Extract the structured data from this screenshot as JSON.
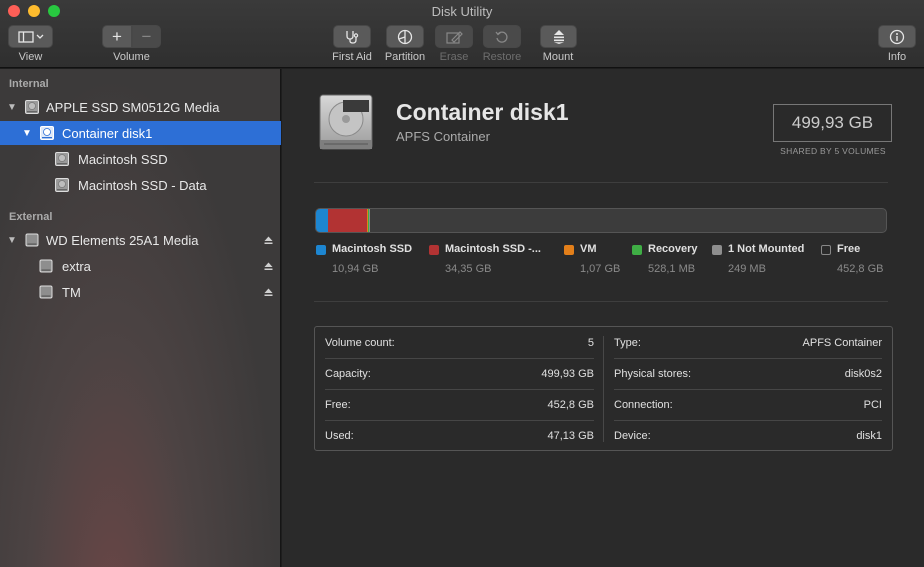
{
  "window": {
    "title": "Disk Utility"
  },
  "toolbar": {
    "view_label": "View",
    "volume_label": "Volume",
    "first_aid_label": "First Aid",
    "partition_label": "Partition",
    "erase_label": "Erase",
    "restore_label": "Restore",
    "mount_label": "Mount",
    "info_label": "Info",
    "add_glyph": "+",
    "remove_glyph": "−"
  },
  "sidebar": {
    "internal_label": "Internal",
    "external_label": "External",
    "internal_items": [
      {
        "label": "APPLE SSD SM0512G Media"
      },
      {
        "label": "Container disk1"
      },
      {
        "label": "Macintosh SSD"
      },
      {
        "label": "Macintosh SSD - Data"
      }
    ],
    "external_items": [
      {
        "label": "WD Elements 25A1 Media"
      },
      {
        "label": "extra"
      },
      {
        "label": "TM"
      }
    ]
  },
  "main": {
    "title": "Container disk1",
    "subtitle": "APFS Container",
    "size": "499,93 GB",
    "shared_by": "SHARED BY 5 VOLUMES",
    "usage": [
      {
        "name": "Macintosh SSD",
        "size": "10,94 GB",
        "color": "#1d86d1",
        "fraction": 0.0219
      },
      {
        "name": "Macintosh SSD -...",
        "size": "34,35 GB",
        "color": "#b23333",
        "fraction": 0.0687
      },
      {
        "name": "VM",
        "size": "1,07 GB",
        "color": "#e37f1a",
        "fraction": 0.0021
      },
      {
        "name": "Recovery",
        "size": "528,1 MB",
        "color": "#3fae45",
        "fraction": 0.0011
      },
      {
        "name": "1 Not Mounted",
        "size": "249 MB",
        "color": "#8e8e8e",
        "fraction": 0.0005
      },
      {
        "name": "Free",
        "size": "452,8 GB",
        "color": "#3c3c3c",
        "fraction": 0.9057
      }
    ],
    "info_left": [
      {
        "label": "Volume count:",
        "value": "5"
      },
      {
        "label": "Capacity:",
        "value": "499,93 GB"
      },
      {
        "label": "Free:",
        "value": "452,8 GB"
      },
      {
        "label": "Used:",
        "value": "47,13 GB"
      }
    ],
    "info_right": [
      {
        "label": "Type:",
        "value": "APFS Container"
      },
      {
        "label": "Physical stores:",
        "value": "disk0s2"
      },
      {
        "label": "Connection:",
        "value": "PCI"
      },
      {
        "label": "Device:",
        "value": "disk1"
      }
    ]
  }
}
